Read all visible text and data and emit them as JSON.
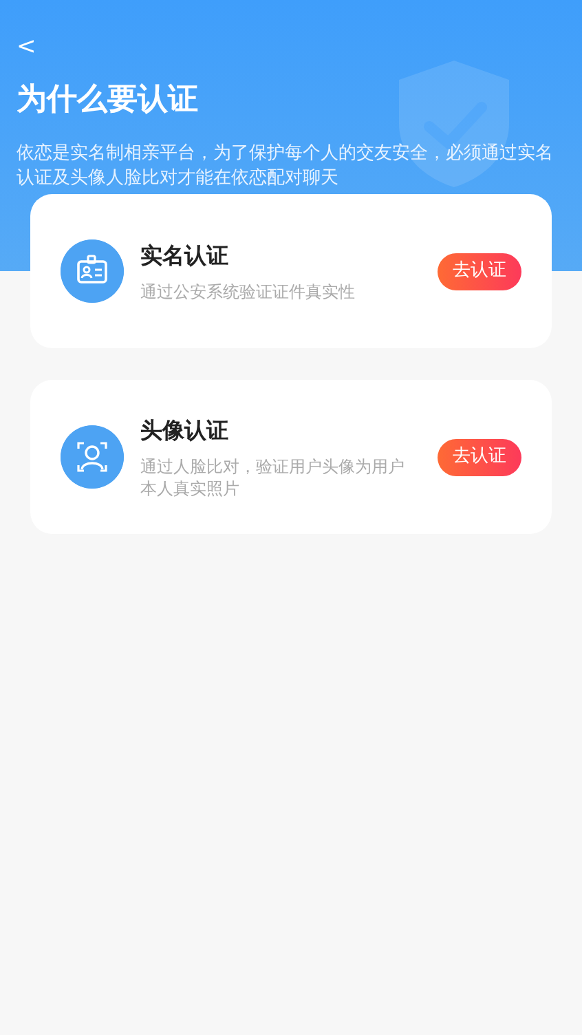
{
  "header": {
    "back": "<",
    "title": "为什么要认证",
    "description": "依恋是实名制相亲平台，为了保护每个人的交友安全，必须通过实名认证及头像人脸比对才能在依恋配对聊天"
  },
  "verifications": [
    {
      "kind": "id-card",
      "title": "实名认证",
      "subtitle": "通过公安系统验证证件真实性",
      "action": "去认证"
    },
    {
      "kind": "face",
      "title": "头像认证",
      "subtitle": "通过人脸比对，验证用户头像为用户本人真实照片",
      "action": "去认证"
    }
  ]
}
